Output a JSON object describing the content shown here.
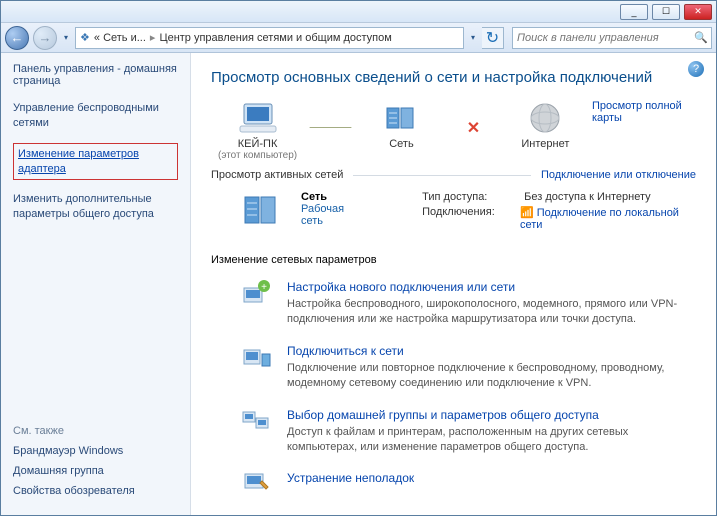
{
  "titlebar": {
    "minimize": "_",
    "maximize": "☐",
    "close": "✕"
  },
  "nav": {
    "back": "←",
    "forward": "→",
    "crumb0_icon": "❖",
    "crumb1": "« Сеть и...",
    "crumb2": "Центр управления сетями и общим доступом",
    "dropdown": "▾",
    "refresh": "↻"
  },
  "search": {
    "placeholder": "Поиск в панели управления",
    "icon": "🔍"
  },
  "sidebar": {
    "title": "Панель управления - домашняя страница",
    "links": [
      "Управление беспроводными сетями",
      "Изменение параметров адаптера",
      "Изменить дополнительные параметры общего доступа"
    ],
    "see_also": "См. также",
    "bottom": [
      "Брандмауэр Windows",
      "Домашняя группа",
      "Свойства обозревателя"
    ]
  },
  "main": {
    "help": "?",
    "title": "Просмотр основных сведений о сети и настройка подключений",
    "map": {
      "this_pc": "КЕЙ-ПК",
      "this_pc_sub": "(этот компьютер)",
      "network": "Сеть",
      "internet": "Интернет",
      "connector_ok": "— — —",
      "connector_bad": "✕",
      "full_map": "Просмотр полной карты"
    },
    "active_header": "Просмотр активных сетей",
    "active_link": "Подключение или отключение",
    "net": {
      "name": "Сеть",
      "type": "Рабочая сеть",
      "access_k": "Тип доступа:",
      "access_v": "Без доступа к Интернету",
      "conn_k": "Подключения:",
      "conn_icon": "📶",
      "conn_v": "Подключение по локальной сети"
    },
    "change_header": "Изменение сетевых параметров",
    "items": [
      {
        "title": "Настройка нового подключения или сети",
        "desc": "Настройка беспроводного, широкополосного, модемного, прямого или VPN-подключения или же настройка маршрутизатора или точки доступа."
      },
      {
        "title": "Подключиться к сети",
        "desc": "Подключение или повторное подключение к беспроводному, проводному, модемному сетевому соединению или подключение к VPN."
      },
      {
        "title": "Выбор домашней группы и параметров общего доступа",
        "desc": "Доступ к файлам и принтерам, расположенным на других сетевых компьютерах, или изменение параметров общего доступа."
      },
      {
        "title": "Устранение неполадок",
        "desc": ""
      }
    ]
  }
}
